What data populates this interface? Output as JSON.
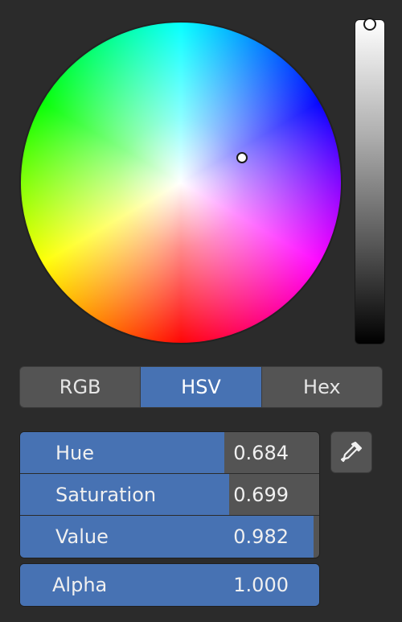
{
  "color_picker": {
    "mode_tabs": [
      {
        "label": "RGB",
        "active": false
      },
      {
        "label": "HSV",
        "active": true
      },
      {
        "label": "Hex",
        "active": false
      }
    ],
    "fields": [
      {
        "label": "Hue",
        "value": "0.684",
        "level": 0.684
      },
      {
        "label": "Saturation",
        "value": "0.699",
        "level": 0.699
      },
      {
        "label": "Value",
        "value": "0.982",
        "level": 0.982
      }
    ],
    "alpha": {
      "label": "Alpha",
      "value": "1.000",
      "level": 1.0
    },
    "accent_color": "#4772b3",
    "eyedropper_icon": "eyedropper-icon"
  }
}
